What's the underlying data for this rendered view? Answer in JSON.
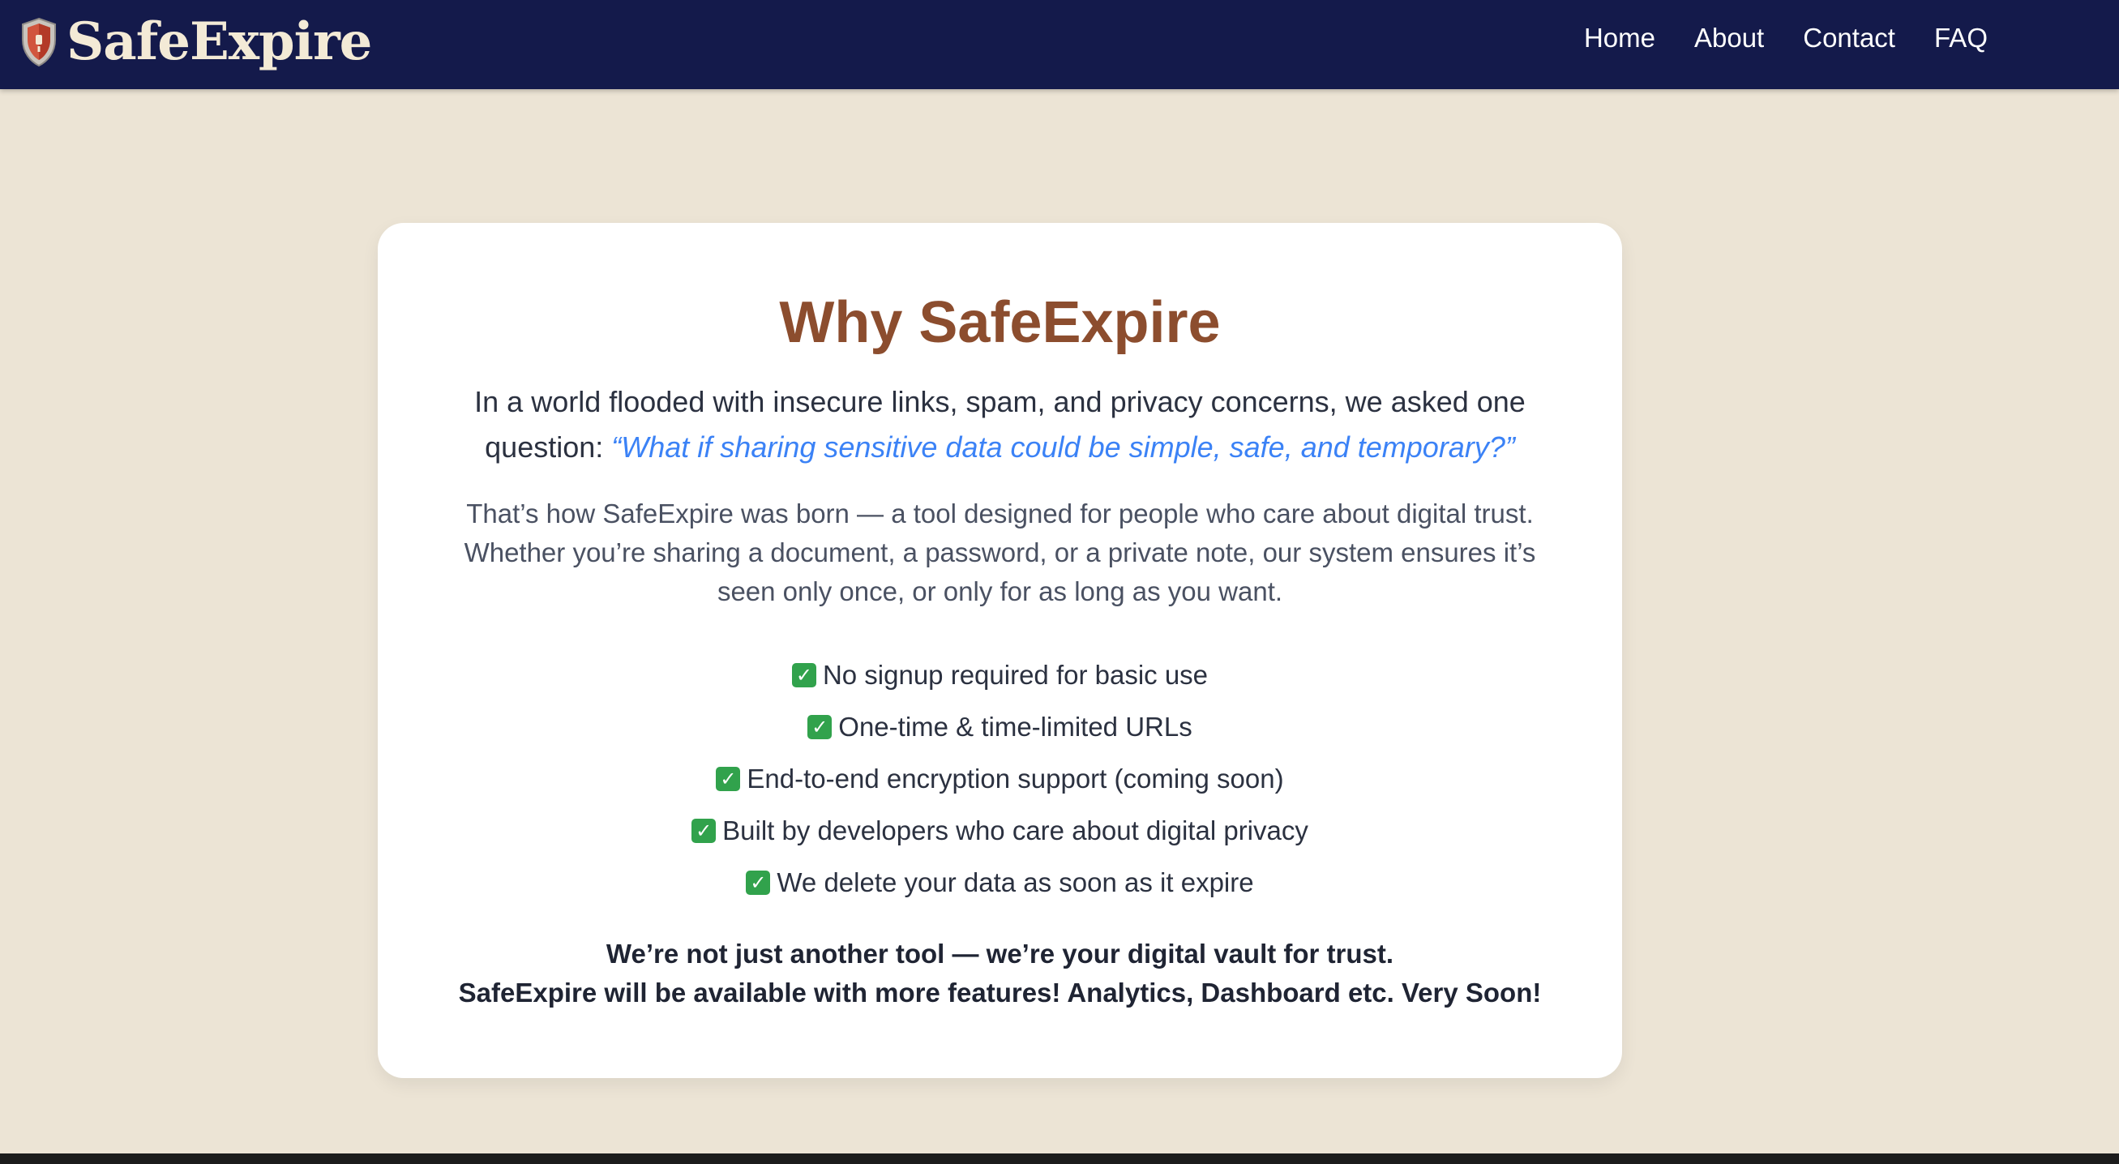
{
  "header": {
    "brand": "SafeExpire",
    "logo_icon": "shield-icon",
    "nav": [
      {
        "label": "Home"
      },
      {
        "label": "About"
      },
      {
        "label": "Contact"
      },
      {
        "label": "FAQ"
      }
    ]
  },
  "card": {
    "title": "Why SafeExpire",
    "intro_text": "In a world flooded with insecure links, spam, and privacy concerns, we asked one question: ",
    "intro_quote": "“What if sharing sensitive data could be simple, safe, and temporary?”",
    "story": "That’s how SafeExpire was born — a tool designed for people who care about digital trust. Whether you’re sharing a document, a password, or a private note, our system ensures it’s seen only once, or only for as long as you want.",
    "features": [
      {
        "icon": "check-icon",
        "label": "No signup required for basic use"
      },
      {
        "icon": "check-icon",
        "label": "One-time & time-limited URLs"
      },
      {
        "icon": "check-icon",
        "label": "End-to-end encryption support (coming soon)"
      },
      {
        "icon": "check-icon",
        "label": "Built by developers who care about digital privacy"
      },
      {
        "icon": "check-icon",
        "label": "We delete your data as soon as it expire"
      }
    ],
    "closing_line1": "We’re not just another tool — we’re your digital vault for trust.",
    "closing_line2": "SafeExpire will be available with more features! Analytics, Dashboard etc. Very Soon!"
  },
  "colors": {
    "navbar": "#141a4b",
    "page_background": "#ece4d5",
    "title": "#8c4d2e",
    "quote": "#3b82f6",
    "check": "#31a24c"
  }
}
